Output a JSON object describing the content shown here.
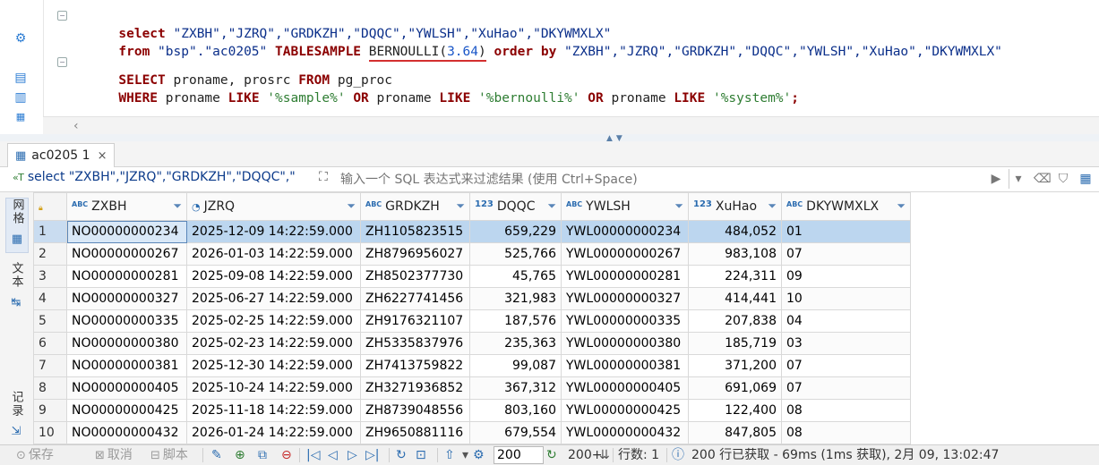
{
  "editor": {
    "line1": {
      "kw_select": "select",
      "cols": "\"ZXBH\",\"JZRQ\",\"GRDKZH\",\"DQQC\",\"YWLSH\",\"XuHao\",\"DKYWMXLX\""
    },
    "line2": {
      "kw_from": "from",
      "table": "\"bsp\".\"ac0205\"",
      "kw_tablesample": "TABLESAMPLE",
      "method": "BERNOULLI",
      "paren_open": "(",
      "percent": "3.64",
      "paren_close": ")",
      "kw_order": "order by",
      "cols": "\"ZXBH\",\"JZRQ\",\"GRDKZH\",\"DQQC\",\"YWLSH\",\"XuHao\",\"DKYWMXLX\""
    },
    "line3": {
      "kw_select": "SELECT",
      "cols": "proname, prosrc",
      "kw_from": "FROM",
      "table": "pg_proc"
    },
    "line4": {
      "kw_where": "WHERE",
      "col": "proname",
      "kw_like": "LIKE",
      "lit1": "'%sample%'",
      "kw_or": "OR",
      "lit2": "'%bernoulli%'",
      "lit3": "'%system%'",
      "end": ";"
    }
  },
  "tab": {
    "label": "ac0205 1",
    "close": "×"
  },
  "filter": {
    "sql_preview": "select \"ZXBH\",\"JZRQ\",\"GRDKZH\",\"DQQC\",\"",
    "placeholder": "输入一个 SQL 表达式来过滤结果 (使用 Ctrl+Space)"
  },
  "side_tabs": {
    "grid": "网格",
    "text": "文本",
    "record": "记录"
  },
  "grid": {
    "columns": [
      {
        "name": "ZXBH",
        "type": "ABC"
      },
      {
        "name": "JZRQ",
        "type": "clock"
      },
      {
        "name": "GRDKZH",
        "type": "ABC"
      },
      {
        "name": "DQQC",
        "type": "123"
      },
      {
        "name": "YWLSH",
        "type": "ABC"
      },
      {
        "name": "XuHao",
        "type": "123"
      },
      {
        "name": "DKYWMXLX",
        "type": "ABC"
      }
    ],
    "rows": [
      {
        "n": "1",
        "ZXBH": "NO00000000234",
        "JZRQ": "2025-12-09 14:22:59.000",
        "GRDKZH": "ZH1105823515",
        "DQQC": "659,229",
        "YWLSH": "YWL00000000234",
        "XuHao": "484,052",
        "DKYWMXLX": "01"
      },
      {
        "n": "2",
        "ZXBH": "NO00000000267",
        "JZRQ": "2026-01-03 14:22:59.000",
        "GRDKZH": "ZH8796956027",
        "DQQC": "525,766",
        "YWLSH": "YWL00000000267",
        "XuHao": "983,108",
        "DKYWMXLX": "07"
      },
      {
        "n": "3",
        "ZXBH": "NO00000000281",
        "JZRQ": "2025-09-08 14:22:59.000",
        "GRDKZH": "ZH8502377730",
        "DQQC": "45,765",
        "YWLSH": "YWL00000000281",
        "XuHao": "224,311",
        "DKYWMXLX": "09"
      },
      {
        "n": "4",
        "ZXBH": "NO00000000327",
        "JZRQ": "2025-06-27 14:22:59.000",
        "GRDKZH": "ZH6227741456",
        "DQQC": "321,983",
        "YWLSH": "YWL00000000327",
        "XuHao": "414,441",
        "DKYWMXLX": "10"
      },
      {
        "n": "5",
        "ZXBH": "NO00000000335",
        "JZRQ": "2025-02-25 14:22:59.000",
        "GRDKZH": "ZH9176321107",
        "DQQC": "187,576",
        "YWLSH": "YWL00000000335",
        "XuHao": "207,838",
        "DKYWMXLX": "04"
      },
      {
        "n": "6",
        "ZXBH": "NO00000000380",
        "JZRQ": "2025-02-23 14:22:59.000",
        "GRDKZH": "ZH5335837976",
        "DQQC": "235,363",
        "YWLSH": "YWL00000000380",
        "XuHao": "185,719",
        "DKYWMXLX": "03"
      },
      {
        "n": "7",
        "ZXBH": "NO00000000381",
        "JZRQ": "2025-12-30 14:22:59.000",
        "GRDKZH": "ZH7413759822",
        "DQQC": "99,087",
        "YWLSH": "YWL00000000381",
        "XuHao": "371,200",
        "DKYWMXLX": "07"
      },
      {
        "n": "8",
        "ZXBH": "NO00000000405",
        "JZRQ": "2025-10-24 14:22:59.000",
        "GRDKZH": "ZH3271936852",
        "DQQC": "367,312",
        "YWLSH": "YWL00000000405",
        "XuHao": "691,069",
        "DKYWMXLX": "07"
      },
      {
        "n": "9",
        "ZXBH": "NO00000000425",
        "JZRQ": "2025-11-18 14:22:59.000",
        "GRDKZH": "ZH8739048556",
        "DQQC": "803,160",
        "YWLSH": "YWL00000000425",
        "XuHao": "122,400",
        "DKYWMXLX": "08"
      },
      {
        "n": "10",
        "ZXBH": "NO00000000432",
        "JZRQ": "2026-01-24 14:22:59.000",
        "GRDKZH": "ZH9650881116",
        "DQQC": "679,554",
        "YWLSH": "YWL00000000432",
        "XuHao": "847,805",
        "DKYWMXLX": "08"
      }
    ]
  },
  "status": {
    "save": "保存",
    "cancel": "取消",
    "script": "脚本",
    "fetch_size": "200",
    "fetch_more": "200+",
    "row_count": "行数: 1",
    "summary": "200 行已获取 - 69ms (1ms 获取), 2月 09, 13:02:47"
  },
  "colors": {
    "keyword": "#8b0000",
    "string": "#0b2f8a",
    "literal": "#2e7d32",
    "number": "#1b57c8",
    "selection": "#bcd6ef",
    "underline": "#d32f2f"
  }
}
